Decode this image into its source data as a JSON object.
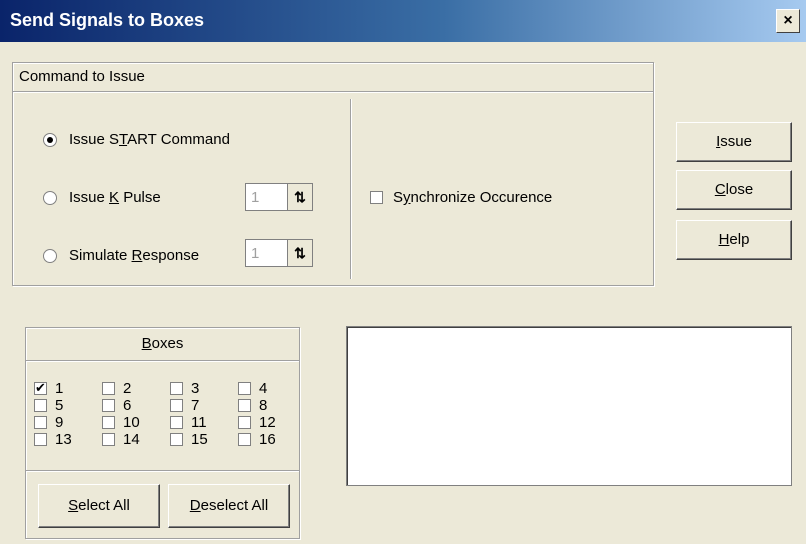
{
  "window": {
    "title": "Send Signals to Boxes",
    "close_glyph": "×"
  },
  "command_group": {
    "label": "Command to Issue",
    "radios": [
      {
        "label_pre": "Issue S",
        "label_u": "T",
        "label_post": "ART Command",
        "checked": true
      },
      {
        "label_pre": "Issue ",
        "label_u": "K",
        "label_post": " Pulse",
        "checked": false
      },
      {
        "label_pre": "Simulate ",
        "label_u": "R",
        "label_post": "esponse",
        "checked": false
      }
    ],
    "k_pulse_value": "1",
    "response_value": "1",
    "synchronize": {
      "label_pre": "S",
      "label_u": "y",
      "label_post": "nchronize Occurence",
      "checked": false
    }
  },
  "buttons": {
    "issue": {
      "pre": "",
      "u": "I",
      "post": "ssue"
    },
    "close": {
      "pre": "",
      "u": "C",
      "post": "lose"
    },
    "help": {
      "pre": "",
      "u": "H",
      "post": "elp"
    }
  },
  "boxes_group": {
    "label_pre": "",
    "label_u": "B",
    "label_post": "oxes",
    "items": [
      {
        "n": "1",
        "checked": true
      },
      {
        "n": "2",
        "checked": false
      },
      {
        "n": "3",
        "checked": false
      },
      {
        "n": "4",
        "checked": false
      },
      {
        "n": "5",
        "checked": false
      },
      {
        "n": "6",
        "checked": false
      },
      {
        "n": "7",
        "checked": false
      },
      {
        "n": "8",
        "checked": false
      },
      {
        "n": "9",
        "checked": false
      },
      {
        "n": "10",
        "checked": false
      },
      {
        "n": "11",
        "checked": false
      },
      {
        "n": "12",
        "checked": false
      },
      {
        "n": "13",
        "checked": false
      },
      {
        "n": "14",
        "checked": false
      },
      {
        "n": "15",
        "checked": false
      },
      {
        "n": "16",
        "checked": false
      }
    ],
    "select_all": {
      "pre": "",
      "u": "S",
      "post": "elect All"
    },
    "deselect_all": {
      "pre": "",
      "u": "D",
      "post": "eselect All"
    }
  }
}
